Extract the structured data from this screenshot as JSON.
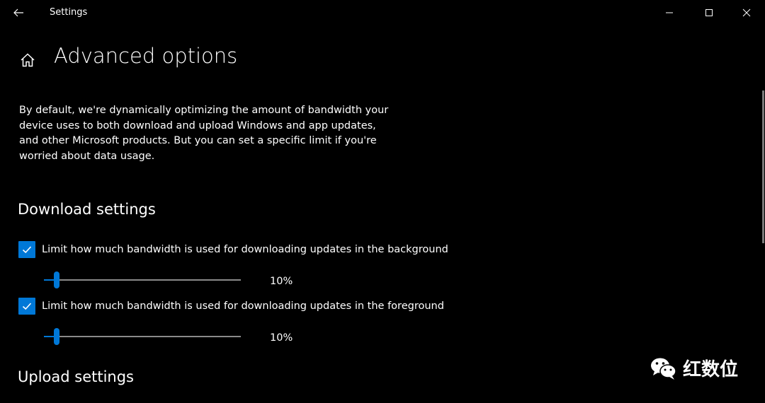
{
  "window": {
    "title": "Settings",
    "back_icon": "arrow-left-icon",
    "controls": [
      "minimize-icon",
      "maximize-icon",
      "close-icon"
    ]
  },
  "page": {
    "home_icon": "home-icon",
    "title": "Advanced options",
    "description": "By default, we're dynamically optimizing the amount of bandwidth your device uses to both download and upload Windows and app updates, and other Microsoft products. But you can set a specific limit if you're worried about data usage."
  },
  "download": {
    "heading": "Download settings",
    "background": {
      "checked": true,
      "label": "Limit how much bandwidth is used for downloading updates in the background",
      "value_percent": 10,
      "value_label": "10%"
    },
    "foreground": {
      "checked": true,
      "label": "Limit how much bandwidth is used for downloading updates in the foreground",
      "value_percent": 10,
      "value_label": "10%"
    }
  },
  "upload": {
    "heading": "Upload settings"
  },
  "watermark": {
    "text": "红数位",
    "icon": "wechat-icon"
  },
  "colors": {
    "accent": "#0078d7",
    "background": "#000000",
    "text": "#ffffff",
    "track": "#8a8a8a"
  }
}
